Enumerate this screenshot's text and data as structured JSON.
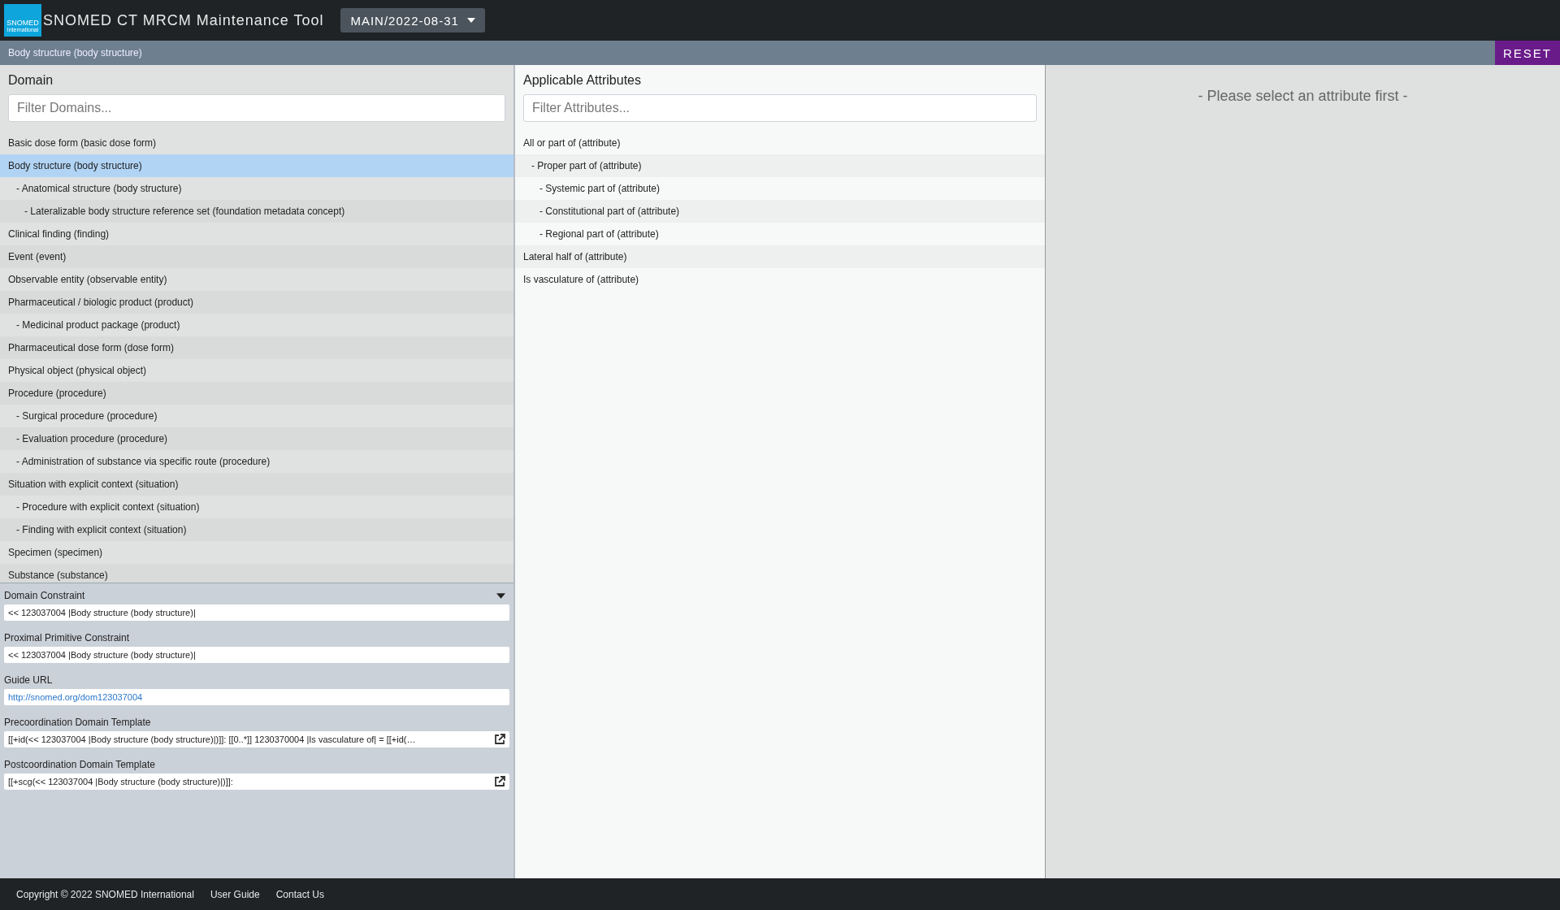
{
  "header": {
    "logo_text": "SNOMED",
    "logo_subtext": "International",
    "title": "SNOMED CT MRCM Maintenance Tool",
    "branch": "MAIN/2022-08-31"
  },
  "breadcrumb": {
    "text": "Body structure (body structure)",
    "reset_label": "RESET"
  },
  "domain": {
    "title": "Domain",
    "filter": {
      "placeholder": "Filter Domains..."
    },
    "items": [
      {
        "label": "Basic dose form (basic dose form)",
        "selected": false
      },
      {
        "label": "Body structure (body structure)",
        "selected": true,
        "children": [
          {
            "label": "- Anatomical structure (body structure)",
            "selected": false,
            "children": [
              {
                "label": "- Lateralizable body structure reference set (foundation metadata concept)",
                "selected": false
              }
            ]
          }
        ]
      },
      {
        "label": "Clinical finding (finding)",
        "selected": false
      },
      {
        "label": "Event (event)",
        "selected": false
      },
      {
        "label": "Observable entity (observable entity)",
        "selected": false
      },
      {
        "label": "Pharmaceutical / biologic product (product)",
        "selected": false,
        "children": [
          {
            "label": "- Medicinal product package (product)",
            "selected": false
          }
        ]
      },
      {
        "label": "Pharmaceutical dose form (dose form)",
        "selected": false
      },
      {
        "label": "Physical object (physical object)",
        "selected": false
      },
      {
        "label": "Procedure (procedure)",
        "selected": false,
        "children": [
          {
            "label": "- Surgical procedure (procedure)",
            "selected": false
          },
          {
            "label": "- Evaluation procedure (procedure)",
            "selected": false
          },
          {
            "label": "- Administration of substance via specific route (procedure)",
            "selected": false
          }
        ]
      },
      {
        "label": "Situation with explicit context (situation)",
        "selected": false,
        "children": [
          {
            "label": "- Procedure with explicit context (situation)",
            "selected": false
          },
          {
            "label": "- Finding with explicit context (situation)",
            "selected": false
          }
        ]
      },
      {
        "label": "Specimen (specimen)",
        "selected": false
      },
      {
        "label": "Substance (substance)",
        "selected": false
      }
    ]
  },
  "details": {
    "expanded": true,
    "fields": [
      {
        "label": "Domain Constraint",
        "value": "<< 123037004 |Body structure (body structure)|",
        "kind": "text"
      },
      {
        "label": "Proximal Primitive Constraint",
        "value": "<< 123037004 |Body structure (body structure)|",
        "kind": "text"
      },
      {
        "label": "Guide URL",
        "value": "http://snomed.org/dom123037004",
        "kind": "link"
      },
      {
        "label": "Precoordination Domain Template",
        "value": "[[+id(<< 123037004 |Body structure (body structure)|)]]: [[0..*]] 1230370004 |Is vasculature of| = [[+id(…",
        "kind": "template"
      },
      {
        "label": "Postcoordination Domain Template",
        "value": "[[+scg(<< 123037004 |Body structure (body structure)|)]]:",
        "kind": "template"
      }
    ]
  },
  "attributes": {
    "title": "Applicable Attributes",
    "filter": {
      "placeholder": "Filter Attributes..."
    },
    "items": [
      {
        "label": "All or part of (attribute)",
        "selected": false,
        "children": [
          {
            "label": "- Proper part of (attribute)",
            "selected": false,
            "children": [
              {
                "label": "- Systemic part of (attribute)",
                "selected": false
              },
              {
                "label": "- Constitutional part of (attribute)",
                "selected": false
              },
              {
                "label": "- Regional part of (attribute)",
                "selected": false
              }
            ]
          }
        ]
      },
      {
        "label": "Lateral half of (attribute)",
        "selected": false
      },
      {
        "label": "Is vasculature of (attribute)",
        "selected": false
      }
    ]
  },
  "detail_panel": {
    "message": "- Please select an attribute first -"
  },
  "footer": {
    "copyright": "Copyright © 2022 SNOMED International",
    "links": [
      "User Guide",
      "Contact Us"
    ]
  }
}
